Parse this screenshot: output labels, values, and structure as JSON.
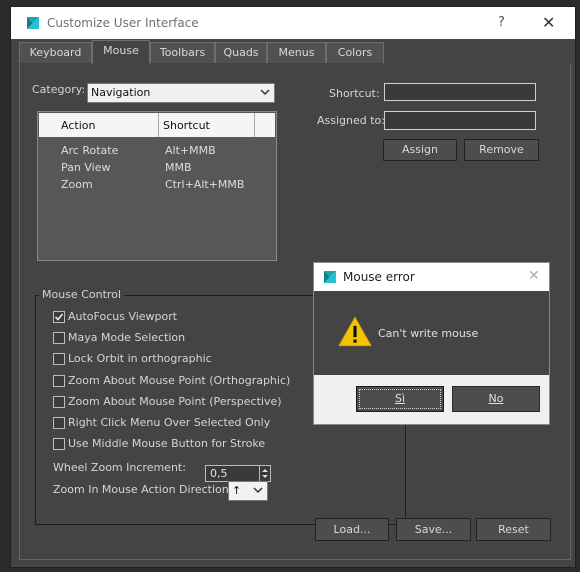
{
  "window": {
    "title": "Customize User Interface",
    "help_symbol": "?",
    "close_symbol": "✕"
  },
  "tabs": [
    "Keyboard",
    "Mouse",
    "Toolbars",
    "Quads",
    "Menus",
    "Colors"
  ],
  "active_tab": "Mouse",
  "category": {
    "label": "Category:",
    "value": "Navigation"
  },
  "list": {
    "headers": [
      "Action",
      "Shortcut"
    ],
    "rows": [
      {
        "action": "Arc Rotate",
        "shortcut": "Alt+MMB"
      },
      {
        "action": "Pan View",
        "shortcut": "MMB"
      },
      {
        "action": "Zoom",
        "shortcut": "Ctrl+Alt+MMB"
      }
    ]
  },
  "shortcut": {
    "label": "Shortcut:",
    "value": ""
  },
  "assigned_to": {
    "label": "Assigned to:",
    "value": ""
  },
  "buttons": {
    "assign": "Assign",
    "remove": "Remove",
    "load": "Load...",
    "save": "Save...",
    "reset": "Reset"
  },
  "mouse_control": {
    "title": "Mouse Control",
    "options": [
      {
        "label": "AutoFocus Viewport",
        "checked": true
      },
      {
        "label": "Maya Mode Selection",
        "checked": false
      },
      {
        "label": "Lock Orbit in orthographic",
        "checked": false
      },
      {
        "label": "Zoom About Mouse Point (Orthographic)",
        "checked": false
      },
      {
        "label": "Zoom About Mouse Point (Perspective)",
        "checked": false
      },
      {
        "label": "Right Click Menu Over Selected Only",
        "checked": false
      },
      {
        "label": "Use Middle Mouse Button for Stroke",
        "checked": false
      }
    ],
    "wheel_zoom": {
      "label": "Wheel Zoom Increment:",
      "value": "0,5"
    },
    "zoom_direction": {
      "label": "Zoom In Mouse Action Direction:",
      "value": "↑"
    }
  },
  "dialog": {
    "title": "Mouse error",
    "message": "Can't write mouse",
    "yes": "Sì",
    "no": "No",
    "close_symbol": "✕"
  },
  "colors": {
    "accent": "#1ba5b3",
    "warning": "#f5c400"
  }
}
